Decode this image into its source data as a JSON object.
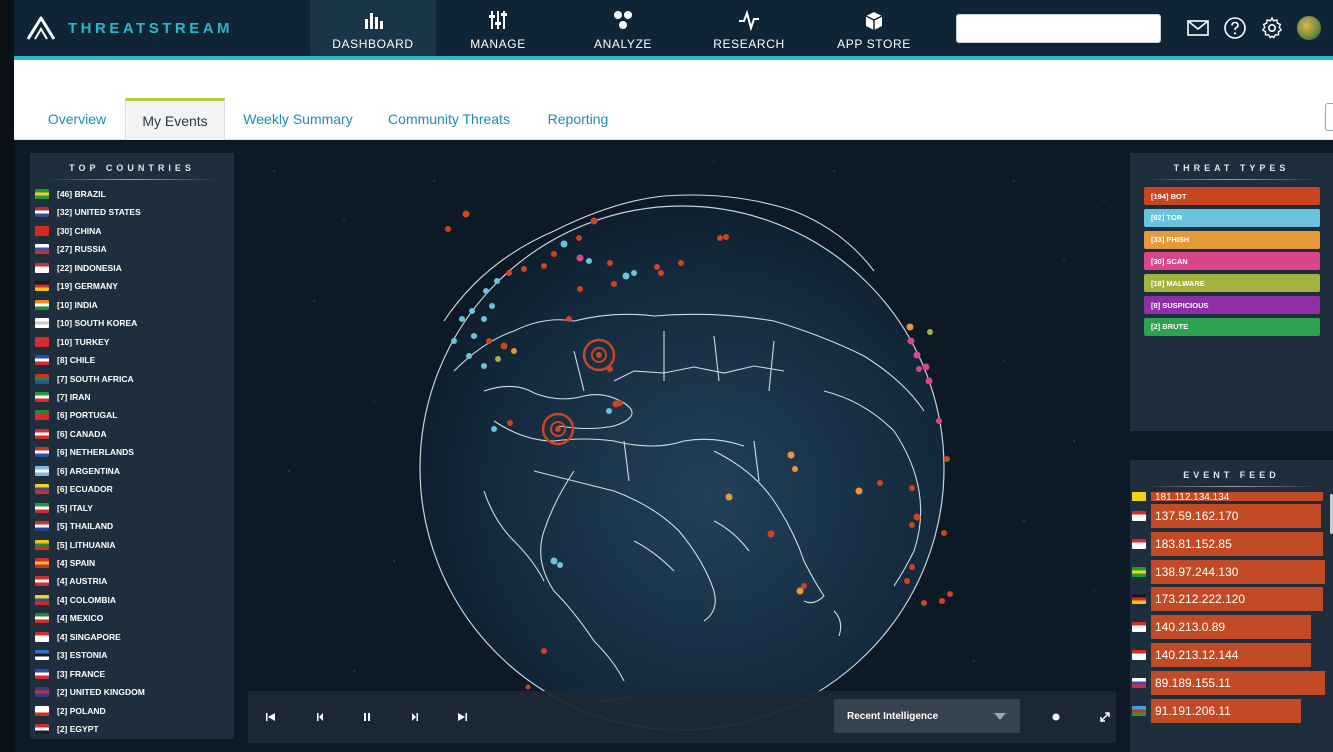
{
  "brand": {
    "name": "THREATSTREAM"
  },
  "nav": {
    "items": [
      {
        "label": "DASHBOARD",
        "icon": "bar-chart-icon",
        "active": true
      },
      {
        "label": "MANAGE",
        "icon": "sliders-icon",
        "active": false
      },
      {
        "label": "ANALYZE",
        "icon": "graph-nodes-icon",
        "active": false
      },
      {
        "label": "RESEARCH",
        "icon": "pulse-icon",
        "active": false
      },
      {
        "label": "APP STORE",
        "icon": "box-icon",
        "active": false
      }
    ],
    "search": {
      "placeholder": "",
      "value": ""
    },
    "icons": [
      "mail-icon",
      "help-icon",
      "gear-icon",
      "avatar"
    ]
  },
  "tabs": [
    {
      "label": "Overview",
      "active": false
    },
    {
      "label": "My Events",
      "active": true
    },
    {
      "label": "Weekly Summary",
      "active": false
    },
    {
      "label": "Community Threats",
      "active": false
    },
    {
      "label": "Reporting",
      "active": false
    }
  ],
  "top_countries": {
    "title": "TOP COUNTRIES",
    "items": [
      {
        "label": "[46] BRAZIL",
        "flag": [
          "#1f9b3a",
          "#f2d21b",
          "#1f9b3a"
        ]
      },
      {
        "label": "[32] UNITED STATES",
        "flag": [
          "#b52f3a",
          "#ffffff",
          "#35508f"
        ]
      },
      {
        "label": "[30] CHINA",
        "flag": [
          "#d42b1f",
          "#d42b1f",
          "#d42b1f"
        ]
      },
      {
        "label": "[27] RUSSIA",
        "flag": [
          "#ffffff",
          "#2f56b4",
          "#d52b2b"
        ]
      },
      {
        "label": "[22] INDONESIA",
        "flag": [
          "#d52b2b",
          "#ffffff",
          "#ffffff"
        ]
      },
      {
        "label": "[19] GERMANY",
        "flag": [
          "#1a1a1a",
          "#d52b2b",
          "#f2c21b"
        ]
      },
      {
        "label": "[10] INDIA",
        "flag": [
          "#f28a1b",
          "#ffffff",
          "#1f8b3a"
        ]
      },
      {
        "label": "[10] SOUTH KOREA",
        "flag": [
          "#ffffff",
          "#c8c8c8",
          "#ffffff"
        ]
      },
      {
        "label": "[10] TURKEY",
        "flag": [
          "#d52b2b",
          "#d52b2b",
          "#d52b2b"
        ]
      },
      {
        "label": "[8] CHILE",
        "flag": [
          "#2a4fa8",
          "#ffffff",
          "#d52b2b"
        ]
      },
      {
        "label": "[7] SOUTH AFRICA",
        "flag": [
          "#d52b2b",
          "#1f8b3a",
          "#2a4fa8"
        ]
      },
      {
        "label": "[7] IRAN",
        "flag": [
          "#1f9b3a",
          "#ffffff",
          "#d52b2b"
        ]
      },
      {
        "label": "[6] PORTUGAL",
        "flag": [
          "#1f8b3a",
          "#d52b2b",
          "#d52b2b"
        ]
      },
      {
        "label": "[6] CANADA",
        "flag": [
          "#d52b2b",
          "#ffffff",
          "#d52b2b"
        ]
      },
      {
        "label": "[6] NETHERLANDS",
        "flag": [
          "#c2362b",
          "#ffffff",
          "#2a4fa8"
        ]
      },
      {
        "label": "[6] ARGENTINA",
        "flag": [
          "#7fb5e6",
          "#ffffff",
          "#7fb5e6"
        ]
      },
      {
        "label": "[6] ECUADOR",
        "flag": [
          "#f2d21b",
          "#2a4fa8",
          "#d52b2b"
        ]
      },
      {
        "label": "[5] ITALY",
        "flag": [
          "#1f9b3a",
          "#ffffff",
          "#d52b2b"
        ]
      },
      {
        "label": "[5] THAILAND",
        "flag": [
          "#d52b2b",
          "#ffffff",
          "#2a3f8f"
        ]
      },
      {
        "label": "[5] LITHUANIA",
        "flag": [
          "#f2c21b",
          "#1f8b3a",
          "#c2362b"
        ]
      },
      {
        "label": "[4] SPAIN",
        "flag": [
          "#d52b2b",
          "#f2c21b",
          "#d52b2b"
        ]
      },
      {
        "label": "[4] AUSTRIA",
        "flag": [
          "#d52b2b",
          "#ffffff",
          "#d52b2b"
        ]
      },
      {
        "label": "[4] COLOMBIA",
        "flag": [
          "#f2d21b",
          "#2a4fa8",
          "#d52b2b"
        ]
      },
      {
        "label": "[4] MEXICO",
        "flag": [
          "#1f8b3a",
          "#ffffff",
          "#d52b2b"
        ]
      },
      {
        "label": "[4] SINGAPORE",
        "flag": [
          "#d52b2b",
          "#ffffff",
          "#ffffff"
        ]
      },
      {
        "label": "[3] ESTONIA",
        "flag": [
          "#3b73c4",
          "#1a1a1a",
          "#ffffff"
        ]
      },
      {
        "label": "[3] FRANCE",
        "flag": [
          "#2a4fa8",
          "#ffffff",
          "#d52b2b"
        ]
      },
      {
        "label": "[2] UNITED KINGDOM",
        "flag": [
          "#2a3f8f",
          "#d52b2b",
          "#2a3f8f"
        ]
      },
      {
        "label": "[2] POLAND",
        "flag": [
          "#ffffff",
          "#ffffff",
          "#d52b2b"
        ]
      },
      {
        "label": "[2] EGYPT",
        "flag": [
          "#d52b2b",
          "#ffffff",
          "#1a1a1a"
        ]
      }
    ]
  },
  "threat_types": {
    "title": "THREAT TYPES",
    "items": [
      {
        "label": "[194] BOT",
        "color": "#c9461f"
      },
      {
        "label": "[62] TOR",
        "color": "#69c3de"
      },
      {
        "label": "[33] PHISH",
        "color": "#e59a3a"
      },
      {
        "label": "[30] SCAN",
        "color": "#d8478a"
      },
      {
        "label": "[18] MALWARE",
        "color": "#a4b33f"
      },
      {
        "label": "[8] SUSPICIOUS",
        "color": "#8e2fa5"
      },
      {
        "label": "[2] BRUTE",
        "color": "#2ea34f"
      }
    ]
  },
  "event_feed": {
    "title": "EVENT FEED",
    "partial_top": "181.112.134.134",
    "items": [
      {
        "ip": "137.59.162.170",
        "flag": [
          "#d52b2b",
          "#ffffff",
          "#ffffff"
        ]
      },
      {
        "ip": "183.81.152.85",
        "flag": [
          "#d52b2b",
          "#ffffff",
          "#ffffff"
        ]
      },
      {
        "ip": "138.97.244.130",
        "flag": [
          "#1f9b3a",
          "#f2d21b",
          "#1f9b3a"
        ]
      },
      {
        "ip": "173.212.222.120",
        "flag": [
          "#1a1a1a",
          "#d52b2b",
          "#f2c21b"
        ]
      },
      {
        "ip": "140.213.0.89",
        "flag": [
          "#d52b2b",
          "#ffffff",
          "#ffffff"
        ]
      },
      {
        "ip": "140.213.12.144",
        "flag": [
          "#d52b2b",
          "#ffffff",
          "#ffffff"
        ]
      },
      {
        "ip": "89.189.155.11",
        "flag": [
          "#ffffff",
          "#2f56b4",
          "#d52b2b"
        ]
      },
      {
        "ip": "91.191.206.11",
        "flag": [
          "#3fa7d6",
          "#d52b2b",
          "#1f9b3a"
        ]
      }
    ]
  },
  "player": {
    "buttons": [
      "skip-first-icon",
      "step-back-icon",
      "pause-icon",
      "step-forward-icon",
      "skip-last-icon"
    ],
    "dropdown": {
      "selected": "Recent Intelligence"
    },
    "extra": [
      "settings-dot-icon",
      "expand-icon"
    ]
  },
  "colors": {
    "accent": "#26b8c7",
    "nav_bg": "#0f2436",
    "bot": "#c9461f",
    "tor": "#69c3de",
    "tab_active_border": "#b5cf3b"
  }
}
